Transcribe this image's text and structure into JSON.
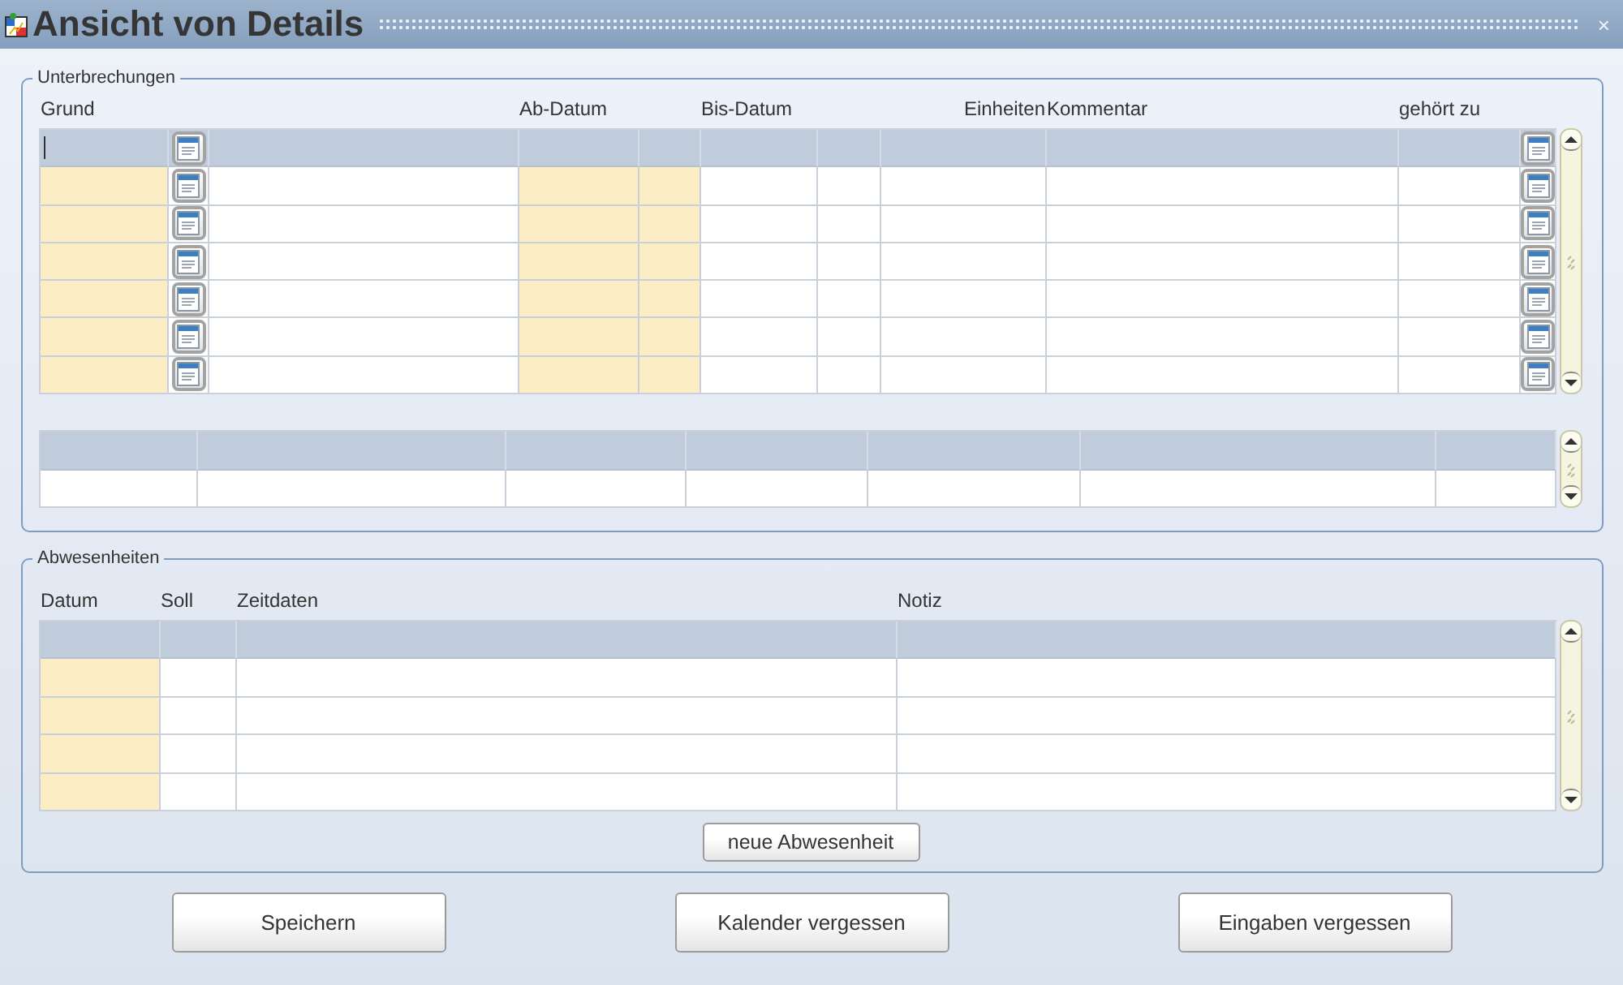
{
  "window": {
    "title": "Ansicht von Details",
    "close": "×"
  },
  "interruptions": {
    "title": "Unterbrechungen",
    "columns": [
      {
        "kind": "text",
        "label": "Grund",
        "required": true
      },
      {
        "kind": "lookup",
        "required": false
      },
      {
        "kind": "text",
        "required": false
      },
      {
        "kind": "text",
        "label": "Ab-Datum",
        "required": true
      },
      {
        "kind": "text",
        "required": true
      },
      {
        "kind": "text",
        "label": "Bis-Datum",
        "required": false
      },
      {
        "kind": "text",
        "required": false
      },
      {
        "kind": "text",
        "label": "Einheiten",
        "required": false
      },
      {
        "kind": "text",
        "label": "Kommentar",
        "required": false
      },
      {
        "kind": "text",
        "label": "gehört zu",
        "required": false
      },
      {
        "kind": "lookup",
        "required": false
      }
    ],
    "rows": [
      {
        "selected": true,
        "focused": true
      },
      {
        "selected": false,
        "focused": false
      },
      {
        "selected": false,
        "focused": false
      },
      {
        "selected": false,
        "focused": false
      },
      {
        "selected": false,
        "focused": false
      },
      {
        "selected": false,
        "focused": false
      },
      {
        "selected": false,
        "focused": false
      }
    ]
  },
  "interruption_details": {
    "columns": [
      {
        "required": false
      },
      {
        "required": false
      },
      {
        "required": false
      },
      {
        "required": false
      },
      {
        "required": false
      },
      {
        "required": false
      },
      {
        "required": false
      }
    ],
    "rows": [
      {
        "selected": true
      },
      {
        "selected": false
      }
    ]
  },
  "absences": {
    "title": "Abwesenheiten",
    "columns": [
      {
        "label": "Datum",
        "required": true
      },
      {
        "label": "Soll",
        "required": false
      },
      {
        "label": "Zeitdaten",
        "required": false
      },
      {
        "label": "Notiz",
        "required": false
      }
    ],
    "rows": [
      {
        "selected": true
      },
      {
        "selected": false
      },
      {
        "selected": false
      },
      {
        "selected": false
      },
      {
        "selected": false
      }
    ],
    "add_button": "neue Abwesenheit"
  },
  "buttons": [
    "Speichern",
    "Kalender vergessen",
    "Eingaben vergessen"
  ]
}
